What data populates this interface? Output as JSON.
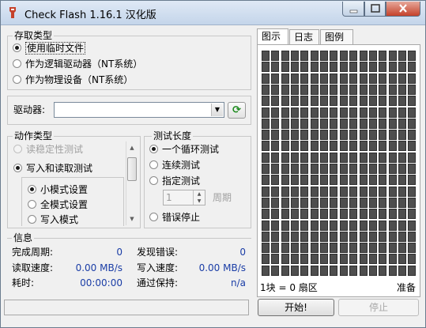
{
  "window": {
    "title": "Check Flash 1.16.1 汉化版",
    "accent": "#c5412a"
  },
  "access_type": {
    "title": "存取类型",
    "options": [
      {
        "label": "使用临时文件",
        "selected": true
      },
      {
        "label": "作为逻辑驱动器（NT系统）",
        "selected": false
      },
      {
        "label": "作为物理设备（NT系统）",
        "selected": false
      }
    ]
  },
  "drive": {
    "label": "驱动器:",
    "value": "",
    "refresh_icon": "refresh-icon"
  },
  "action_type": {
    "title": "动作类型",
    "options": [
      {
        "label": "读稳定性测试",
        "selected": false,
        "enabled": false
      },
      {
        "label": "写入和读取测试",
        "selected": true,
        "enabled": true
      },
      {
        "label": "小模式设置",
        "selected": true,
        "enabled": true
      },
      {
        "label": "全模式设置",
        "selected": false,
        "enabled": true
      },
      {
        "label": "写入模式",
        "selected": false,
        "enabled": true
      }
    ]
  },
  "test_length": {
    "title": "测试长度",
    "options": [
      {
        "label": "一个循环测试",
        "selected": true
      },
      {
        "label": "连续测试",
        "selected": false
      },
      {
        "label": "指定测试",
        "selected": false
      },
      {
        "label": "错误停止",
        "selected": false
      }
    ],
    "cycles_value": "1",
    "cycles_unit": "周期"
  },
  "info": {
    "title": "信息",
    "completed_cycles_label": "完成周期:",
    "completed_cycles_value": "0",
    "errors_found_label": "发现错误:",
    "errors_found_value": "0",
    "read_speed_label": "读取速度:",
    "read_speed_value": "0.00 MB/s",
    "write_speed_label": "写入速度:",
    "write_speed_value": "0.00 MB/s",
    "elapsed_label": "耗时:",
    "elapsed_value": "00:00:00",
    "passes_label": "通过保持:",
    "passes_value": "n/a"
  },
  "tabs": [
    {
      "label": "图示",
      "active": true
    },
    {
      "label": "日志",
      "active": false
    },
    {
      "label": "图例",
      "active": false
    }
  ],
  "map": {
    "block_info": "1块 = 0 扇区",
    "status": "准备",
    "cell_color": "#4e4e4e"
  },
  "buttons": {
    "start": "开始!",
    "stop": "停止"
  },
  "statusbar": {
    "text": ""
  }
}
